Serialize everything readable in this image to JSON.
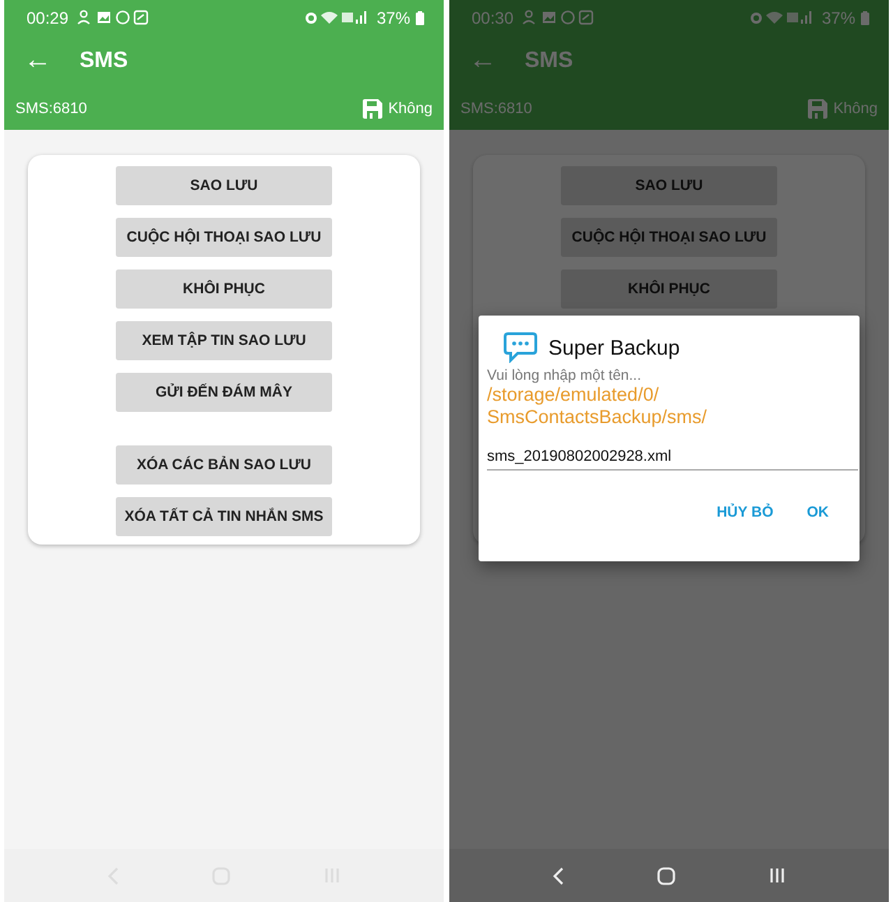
{
  "screens": [
    {
      "dimmed": false,
      "status_bar": {
        "time": "00:29",
        "battery": "37%"
      },
      "toolbar": {
        "back": "←",
        "title": "SMS"
      },
      "info_bar": {
        "count": "SMS:6810",
        "save_label": "Không"
      },
      "button_groups": [
        [
          "SAO LƯU",
          "CUỘC HỘI THOẠI SAO LƯU",
          "KHÔI PHỤC",
          "XEM TẬP TIN SAO LƯU",
          "GỬI ĐẾN ĐÁM MÂY"
        ],
        [
          "XÓA CÁC BẢN SAO LƯU",
          "XÓA TẤT CẢ TIN NHẮN SMS"
        ]
      ]
    },
    {
      "dimmed": true,
      "status_bar": {
        "time": "00:30",
        "battery": "37%"
      },
      "toolbar": {
        "back": "←",
        "title": "SMS"
      },
      "info_bar": {
        "count": "SMS:6810",
        "save_label": "Không"
      },
      "button_groups": [
        [
          "SAO LƯU",
          "CUỘC HỘI THOẠI SAO LƯU",
          "KHÔI PHỤC"
        ]
      ],
      "dialog": {
        "title": "Super Backup",
        "hint": "Vui lòng nhập một tên...",
        "path_lines": [
          "/storage/emulated/0/",
          "SmsContactsBackup/sms/"
        ],
        "value": "sms_20190802002928.xml",
        "buttons": [
          "HỦY BỎ",
          "OK"
        ]
      }
    }
  ]
}
